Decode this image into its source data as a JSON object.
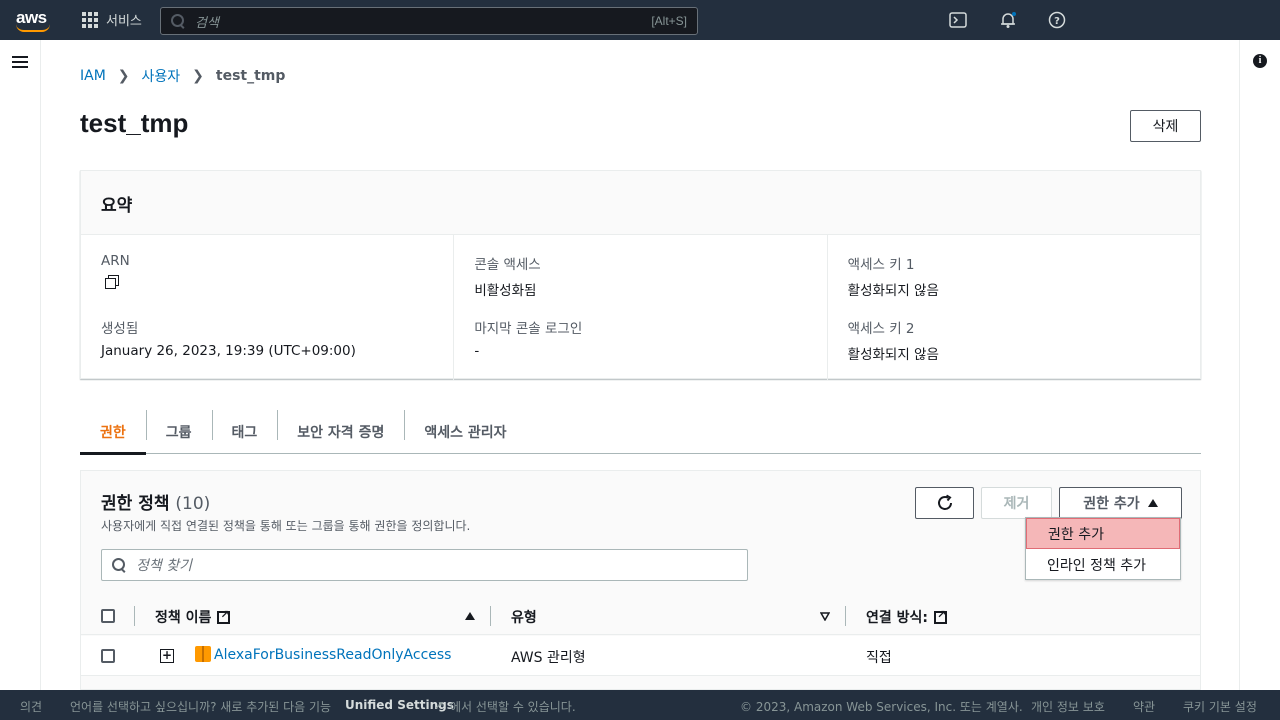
{
  "topnav": {
    "logo": "aws",
    "services_label": "서비스",
    "search_placeholder": "검색",
    "search_shortcut": "[Alt+S]"
  },
  "breadcrumb": {
    "root": "IAM",
    "users": "사용자",
    "current": "test_tmp"
  },
  "page": {
    "title": "test_tmp",
    "delete_label": "삭제"
  },
  "summary": {
    "title": "요약",
    "arn_label": "ARN",
    "created_label": "생성됨",
    "created_value": "January 26, 2023, 19:39 (UTC+09:00)",
    "console_access_label": "콘솔 액세스",
    "console_access_value": "비활성화됨",
    "last_console_login_label": "마지막 콘솔 로그인",
    "last_console_login_value": "-",
    "access_key1_label": "액세스 키 1",
    "access_key1_value": "활성화되지 않음",
    "access_key2_label": "액세스 키 2",
    "access_key2_value": "활성화되지 않음"
  },
  "tabs": [
    {
      "label": "권한"
    },
    {
      "label": "그룹"
    },
    {
      "label": "태그"
    },
    {
      "label": "보안 자격 증명"
    },
    {
      "label": "액세스 관리자"
    }
  ],
  "permissions": {
    "title": "권한 정책",
    "count": "(10)",
    "description": "사용자에게 직접 연결된 정책을 통해 또는 그룹을 통해 권한을 정의합니다.",
    "remove_label": "제거",
    "add_label": "권한 추가",
    "search_placeholder": "정책 찾기",
    "col_policy_name": "정책 이름",
    "col_type": "유형",
    "col_attached_via": "연결 방식:",
    "rows": [
      {
        "name": "AlexaForBusinessReadOnlyAccess",
        "type": "AWS 관리형",
        "attached": "직접"
      }
    ]
  },
  "dropdown": {
    "items": [
      {
        "label": "권한 추가"
      },
      {
        "label": "인라인 정책 추가"
      }
    ]
  },
  "footer": {
    "feedback": "의견",
    "language_prompt": "언어를 선택하고 싶으십니까? 새로 추가된 다음 기능",
    "unified_settings": "Unified Settings",
    "language_prompt_end": "에서 선택할 수 있습니다.",
    "copyright": "© 2023, Amazon Web Services, Inc. 또는 계열사.",
    "privacy": "개인 정보 보호",
    "terms": "약관",
    "cookies": "쿠키 기본 설정"
  }
}
